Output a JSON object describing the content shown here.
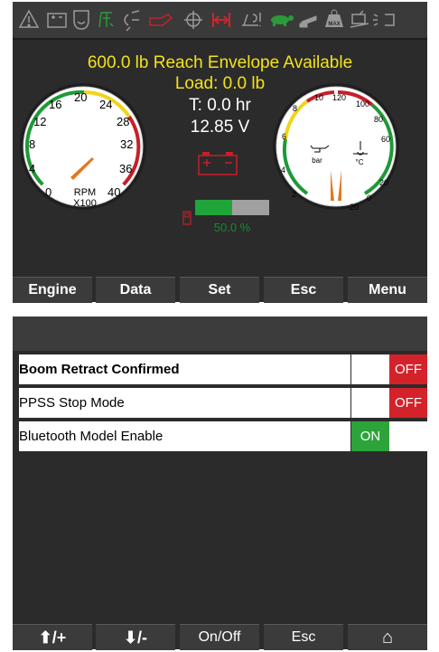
{
  "screen1": {
    "indicators": [
      "warning-triangle",
      "battery-warning",
      "glow-plug",
      "tilt-alarm",
      "headlights",
      "engine-oil",
      "differential-lock",
      "axle-lock",
      "platform-overload",
      "tortoise-mode",
      "boom-icon",
      "max-load",
      "tilt-deck",
      "beacon"
    ],
    "headline": "600.0 lb Reach Envelope Available",
    "load": "Load: 0.0 lb",
    "hours": "T: 0.0 hr",
    "voltage": "12.85 V",
    "rpm_gauge": {
      "labels": [
        "0",
        "4",
        "8",
        "12",
        "16",
        "20",
        "24",
        "28",
        "32",
        "36",
        "40"
      ],
      "unit_line1": "RPM",
      "unit_line2": "X100",
      "value": 4
    },
    "temp_gauge": {
      "left_labels": [
        "2",
        "4",
        "6",
        "8",
        "10"
      ],
      "right_labels": [
        "-20",
        "0",
        "20",
        "60",
        "80",
        "100",
        "120"
      ],
      "left_unit": "bar",
      "right_unit": "°C"
    },
    "fuel_percent_value": 50,
    "fuel_percent": "50.0 %",
    "softkeys": [
      "Engine",
      "Data",
      "Set",
      "Esc",
      "Menu"
    ]
  },
  "screen2": {
    "rows": [
      {
        "label": "Boom Retract Confirmed",
        "state": "OFF",
        "bold": true
      },
      {
        "label": "PPSS Stop Mode",
        "state": "OFF",
        "bold": false
      },
      {
        "label": "Bluetooth Model Enable",
        "state": "ON",
        "bold": false
      }
    ],
    "softkeys": [
      "⬆/+",
      "⬇/-",
      "On/Off",
      "Esc",
      "⌂"
    ]
  },
  "colors": {
    "yellow_text": "#f4e21a",
    "on_green": "#2ca43a",
    "off_red": "#d3222a"
  }
}
